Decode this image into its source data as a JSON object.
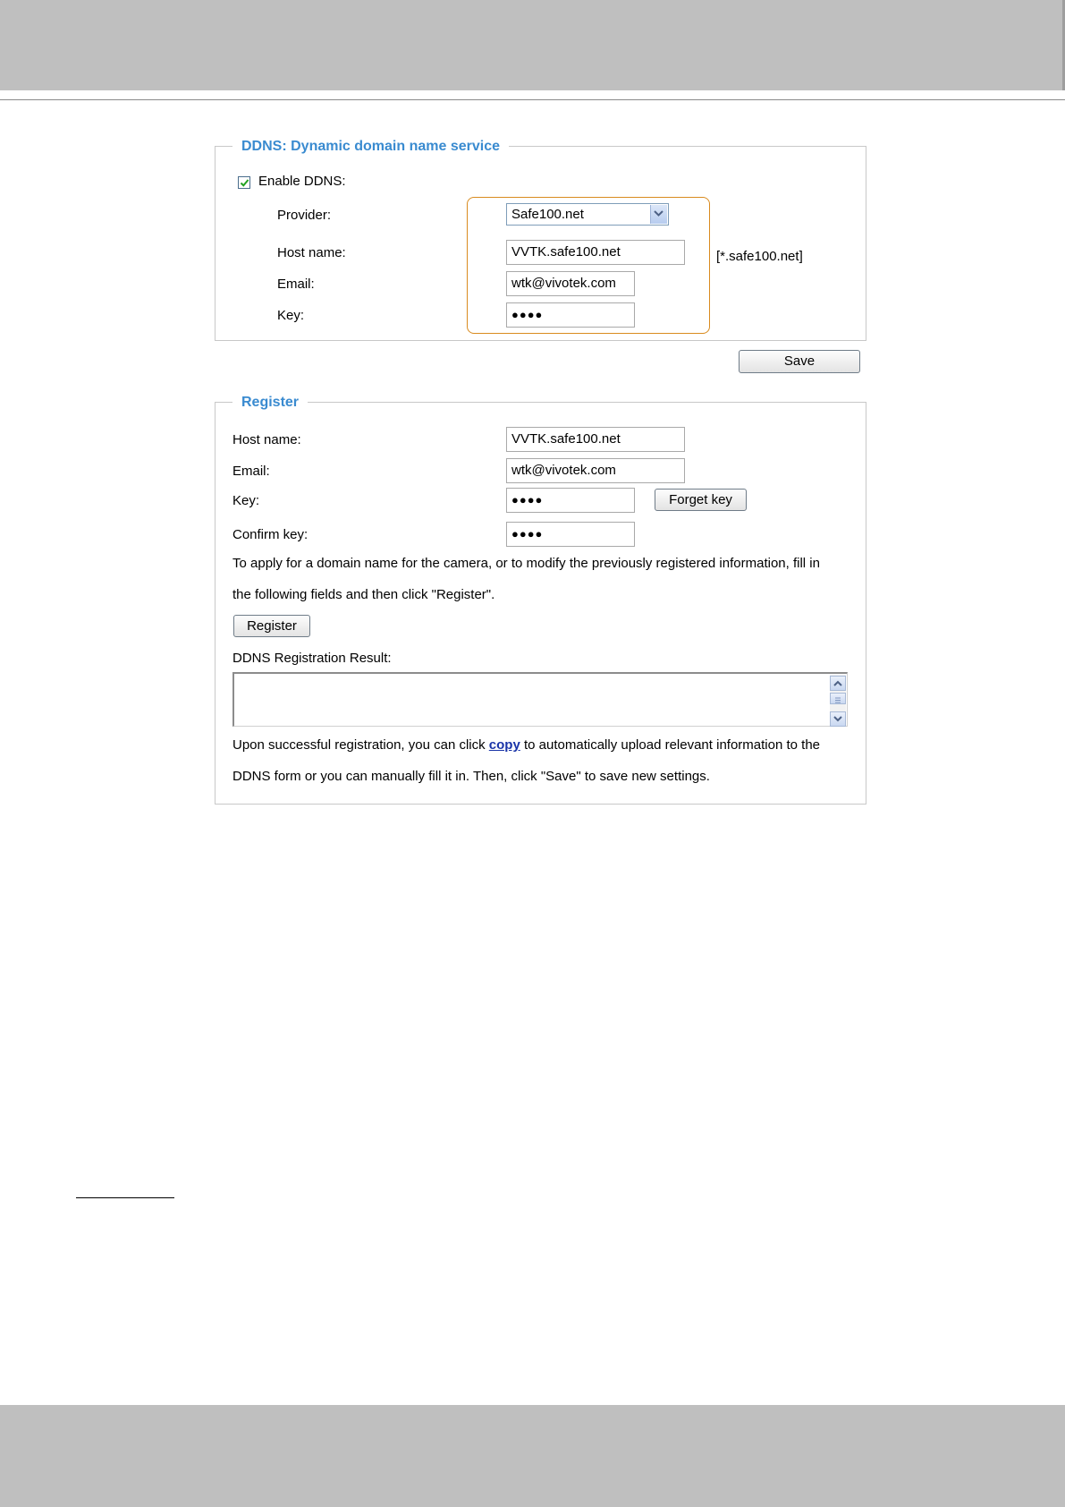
{
  "ddns": {
    "legend": "DDNS: Dynamic domain name service",
    "enable_label": "Enable DDNS:",
    "enabled": true,
    "provider_label": "Provider:",
    "provider_value": "Safe100.net",
    "hostname_label": "Host name:",
    "hostname_value": "VVTK.safe100.net",
    "hostname_suffix": "[*.safe100.net]",
    "email_label": "Email:",
    "email_value": "wtk@vivotek.com",
    "key_label": "Key:",
    "key_value": "●●●●",
    "highlight_color": "#d98b1f"
  },
  "save_label": "Save",
  "register": {
    "legend": "Register",
    "hostname_label": "Host name:",
    "hostname_value": "VVTK.safe100.net",
    "email_label": "Email:",
    "email_value": "wtk@vivotek.com",
    "key_label": "Key:",
    "key_value": "●●●●",
    "forget_key_label": "Forget key",
    "confirm_key_label": "Confirm key:",
    "confirm_key_value": "●●●●",
    "instructions_line1": "To apply for a domain name for the camera, or to modify the previously registered information, fill in",
    "instructions_line2": "the following fields and then click \"Register\".",
    "register_button_label": "Register",
    "result_label": "DDNS Registration Result:",
    "result_value": "",
    "info_line1_before": "Upon successful registration, you can click ",
    "info_link": "copy",
    "info_line1_after": " to automatically upload relevant information to the",
    "info_line2": "DDNS form or you can manually fill it in. Then, click \"Save\" to save new settings."
  },
  "colors": {
    "legend": "#3a8bd0",
    "link": "#1a34a8",
    "bars": "#bfbfbf"
  }
}
